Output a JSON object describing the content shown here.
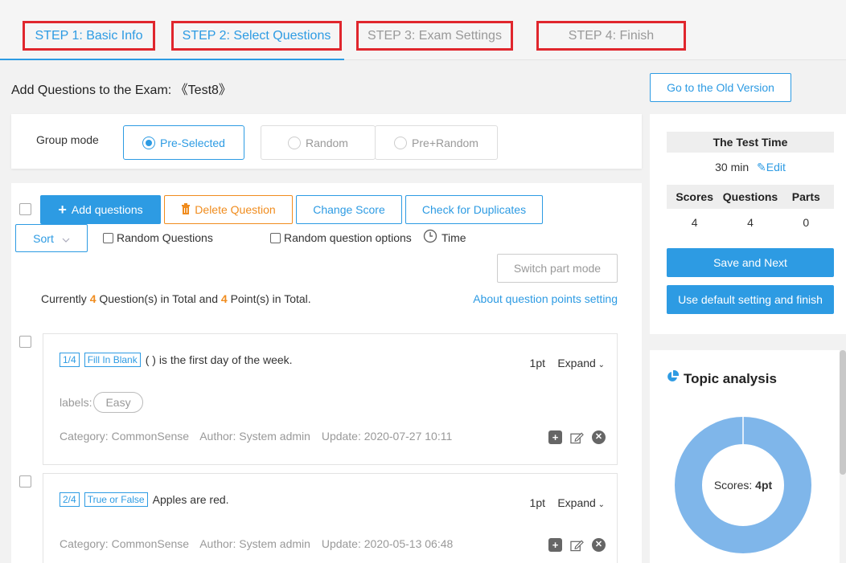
{
  "steps": [
    {
      "label": "STEP 1: Basic Info",
      "state": "done"
    },
    {
      "label": "STEP 2: Select Questions",
      "state": "active"
    },
    {
      "label": "STEP 3: Exam Settings",
      "state": "pending"
    },
    {
      "label": "STEP 4: Finish",
      "state": "pending"
    }
  ],
  "header": {
    "title": "Add Questions to the Exam: 《Test8》",
    "old_version_label": "Go to the Old Version"
  },
  "group_mode": {
    "label": "Group mode",
    "options": [
      "Pre-Selected",
      "Random",
      "Pre+Random"
    ],
    "selected": "Pre-Selected"
  },
  "toolbar": {
    "add_label": "Add questions",
    "delete_label": "Delete Question",
    "change_score_label": "Change Score",
    "check_duplicates_label": "Check for Duplicates",
    "sort_label": "Sort",
    "random_questions_label": "Random Questions",
    "random_options_label": "Random question options",
    "time_label": "Time",
    "switch_part_label": "Switch part mode"
  },
  "summary": {
    "prefix": "Currently",
    "question_count": "4",
    "middle": "Question(s) in Total and",
    "point_count": "4",
    "suffix": "Point(s) in Total.",
    "about_link": "About question points setting"
  },
  "questions": [
    {
      "index": "1/4",
      "type": "Fill In Blank",
      "text": "( ) is the first day of the week.",
      "points": "1pt",
      "expand_label": "Expand",
      "labels_prefix": "labels:",
      "label": "Easy",
      "category": "Category: CommonSense",
      "author": "Author: System admin",
      "update": "Update: 2020-07-27 10:11"
    },
    {
      "index": "2/4",
      "type": "True or False",
      "text": "Apples are red.",
      "points": "1pt",
      "expand_label": "Expand",
      "category": "Category: CommonSense",
      "author": "Author: System admin",
      "update": "Update: 2020-05-13 06:48"
    }
  ],
  "test_info": {
    "time_header": "The Test Time",
    "time_value": "30 min",
    "edit_label": "Edit",
    "stats_headers": [
      "Scores",
      "Questions",
      "Parts"
    ],
    "stats_values": [
      "4",
      "4",
      "0"
    ],
    "save_next_label": "Save and Next",
    "default_finish_label": "Use default setting and finish"
  },
  "topic": {
    "title": "Topic analysis",
    "scores_label": "Scores:",
    "scores_value": "4pt"
  },
  "colors": {
    "accent": "#2d9be3",
    "warning": "#f08c1e",
    "step_border": "#e0262d",
    "donut": "#7fb6ea"
  }
}
